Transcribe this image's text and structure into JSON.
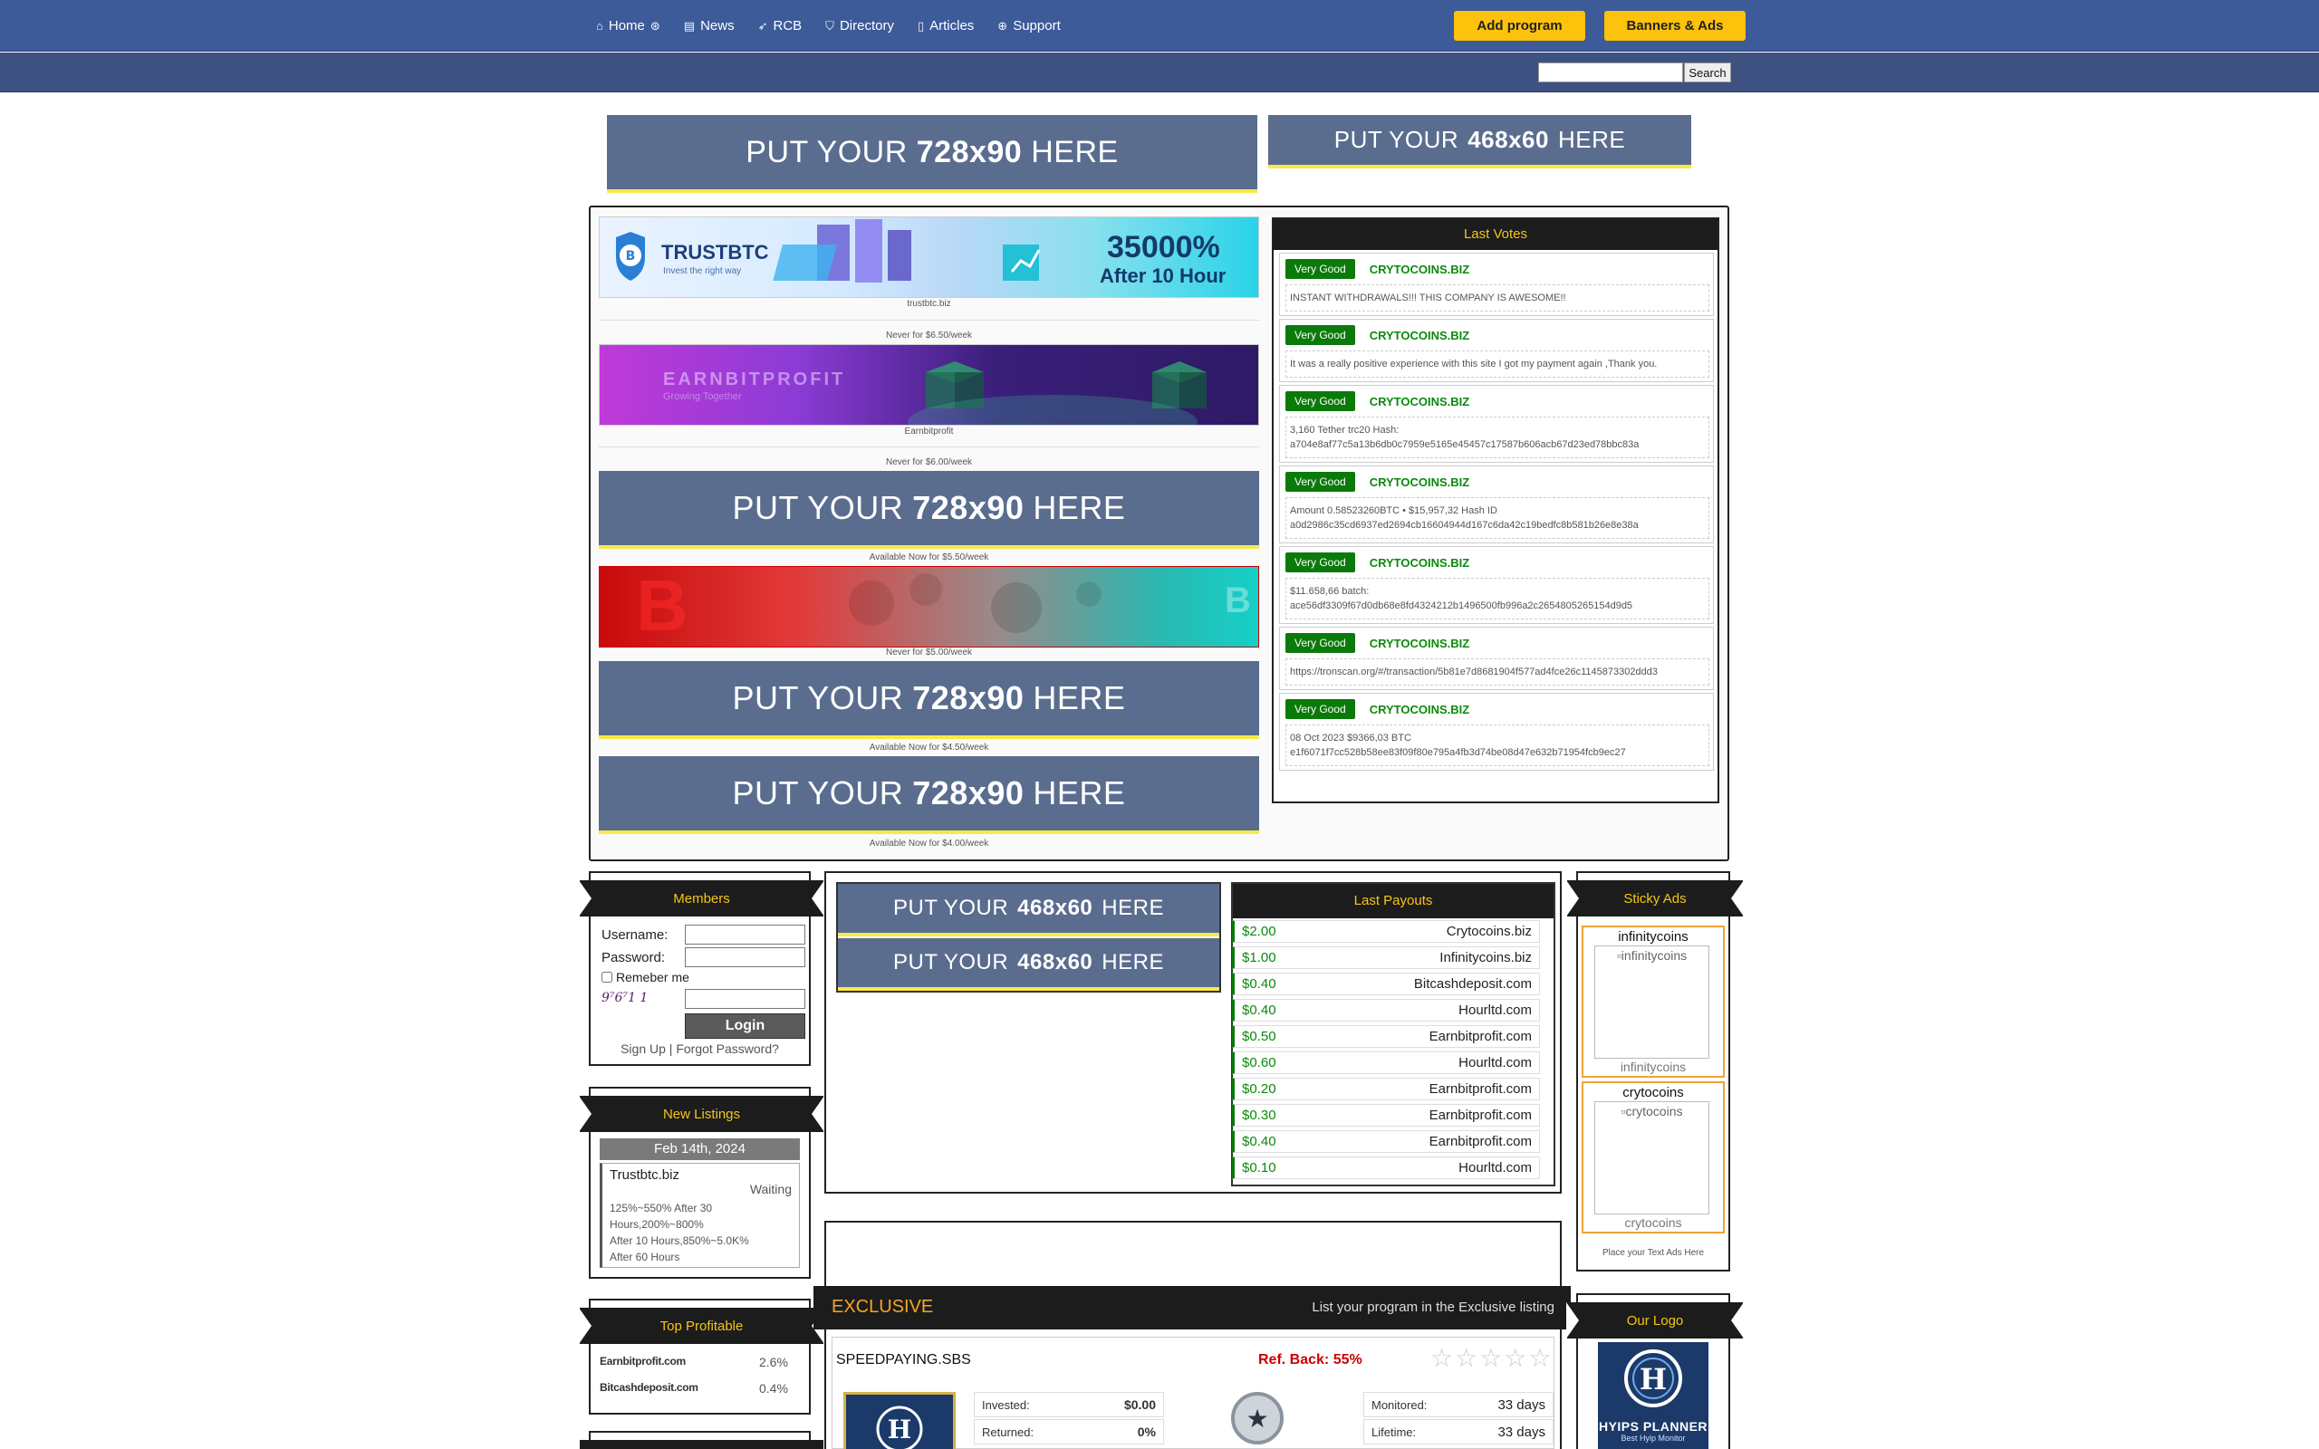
{
  "nav": {
    "items": [
      {
        "label": "Home",
        "icon": "home-icon"
      },
      {
        "label": "News",
        "icon": "newspaper-icon"
      },
      {
        "label": "RCB",
        "icon": "rocket-icon"
      },
      {
        "label": "Directory",
        "icon": "tags-icon"
      },
      {
        "label": "Articles",
        "icon": "file-icon"
      },
      {
        "label": "Support",
        "icon": "lifebuoy-icon"
      }
    ],
    "add_program": "Add program",
    "banners_ads": "Banners & Ads"
  },
  "search": {
    "button": "Search",
    "value": ""
  },
  "placeholders": {
    "put": "PUT YOUR",
    "here": "HERE",
    "size_728": "728x90",
    "size_468": "468x60"
  },
  "ads": [
    {
      "caption": "trustbtc.biz",
      "sub": "Never for $6.50/week",
      "brand": "TRUSTBTC",
      "tagline": "Invest the right way",
      "promo": "35000%",
      "promo2": "After 10 Hour"
    },
    {
      "caption": "Earnbitprofit",
      "sub": "Never for $6.00/week",
      "brand": "EARNBITPROFIT",
      "tagline": "Growing Together"
    },
    {
      "sub": "Available Now for $5.50/week"
    },
    {
      "sub": "Never for $5.00/week"
    },
    {
      "sub": "Available Now for $4.50/week"
    },
    {
      "sub": "Available Now for $4.00/week"
    }
  ],
  "last_votes": {
    "title": "Last Votes",
    "items": [
      {
        "rating": "Very Good",
        "site": "CRYTOCOINS.BIZ",
        "text": [
          "INSTANT WITHDRAWALS!!! THIS COMPANY IS AWESOME!!"
        ]
      },
      {
        "rating": "Very Good",
        "site": "CRYTOCOINS.BIZ",
        "text": [
          "It was a really positive experience with this site I got my payment again ,Thank you."
        ]
      },
      {
        "rating": "Very Good",
        "site": "CRYTOCOINS.BIZ",
        "text": [
          "3,160 Tether trc20 Hash:",
          "a704e8af77c5a13b6db0c7959e5165e45457c17587b606acb67d23ed78bbc83a"
        ]
      },
      {
        "rating": "Very Good",
        "site": "CRYTOCOINS.BIZ",
        "text": [
          "Amount 0.58523260BTC • $15,957,32 Hash ID",
          "a0d2986c35cd6937ed2694cb16604944d167c6da42c19bedfc8b581b26e8e38a"
        ]
      },
      {
        "rating": "Very Good",
        "site": "CRYTOCOINS.BIZ",
        "text": [
          "$11.658,66 batch:",
          "ace56df3309f67d0db68e8fd4324212b1496500fb996a2c2654805265154d9d5"
        ]
      },
      {
        "rating": "Very Good",
        "site": "CRYTOCOINS.BIZ",
        "text": [
          "https://tronscan.org/#/transaction/5b81e7d8681904f577ad4fce26c1145873302ddd3"
        ]
      },
      {
        "rating": "Very Good",
        "site": "CRYTOCOINS.BIZ",
        "text": [
          "08 Oct 2023 $9366,03 BTC",
          "e1f6071f7cc528b58ee83f09f80e795a4fb3d74be08d47e632b71954fcb9ec27"
        ]
      }
    ]
  },
  "members": {
    "title": "Members",
    "username_label": "Username:",
    "password_label": "Password:",
    "remember": "Remeber me",
    "captcha": "9⁷6⁷1 1",
    "login": "Login",
    "signup": "Sign Up",
    "separator": "|",
    "forgot": "Forgot Password?"
  },
  "new_listings": {
    "title": "New Listings",
    "date": "Feb 14th, 2024",
    "items": [
      {
        "name": "Trustbtc.biz",
        "status": "Waiting",
        "plan": [
          "125%~550% After 30",
          "Hours,200%~800%",
          "After 10 Hours,850%~5.0K%",
          "After 60 Hours"
        ]
      }
    ]
  },
  "top_profitable": {
    "title": "Top Profitable",
    "items": [
      {
        "site": "Earnbitprofit.com",
        "value": "2.6%"
      },
      {
        "site": "Bitcashdeposit.com",
        "value": "0.4%"
      }
    ]
  },
  "last_payouts": {
    "title": "Last Payouts",
    "items": [
      {
        "amount": "$2.00",
        "site": "Crytocoins.biz"
      },
      {
        "amount": "$1.00",
        "site": "Infinitycoins.biz"
      },
      {
        "amount": "$0.40",
        "site": "Bitcashdeposit.com"
      },
      {
        "amount": "$0.40",
        "site": "Hourltd.com"
      },
      {
        "amount": "$0.50",
        "site": "Earnbitprofit.com"
      },
      {
        "amount": "$0.60",
        "site": "Hourltd.com"
      },
      {
        "amount": "$0.20",
        "site": "Earnbitprofit.com"
      },
      {
        "amount": "$0.30",
        "site": "Earnbitprofit.com"
      },
      {
        "amount": "$0.40",
        "site": "Earnbitprofit.com"
      },
      {
        "amount": "$0.10",
        "site": "Hourltd.com"
      }
    ]
  },
  "sticky_ads": {
    "title": "Sticky Ads",
    "items": [
      {
        "name": "infinitycoins",
        "alt": "infinitycoins",
        "caption": "infinitycoins"
      },
      {
        "name": "crytocoins",
        "alt": "crytocoins",
        "caption": "crytocoins"
      }
    ],
    "footer": "Place your Text Ads Here"
  },
  "exclusive": {
    "title": "EXCLUSIVE",
    "cta": "List your program in the Exclusive listing",
    "program": {
      "name": "SPEEDPAYING.SBS",
      "ref_back": "Ref. Back: 55%",
      "invested_label": "Invested:",
      "invested": "$0.00",
      "returned_label": "Returned:",
      "returned": "0%",
      "monitored_label": "Monitored:",
      "monitored": "33 days",
      "lifetime_label": "Lifetime:",
      "lifetime": "33 days",
      "stars": "☆☆☆☆☆"
    }
  },
  "our_logo": {
    "title": "Our Logo",
    "line1": "HYIPS PLANNER",
    "line2": "Best Hyip Monitor"
  },
  "colors": {
    "nav_bg": "#3d5a99",
    "accent_yellow": "#fcc20c",
    "header_text": "#f5c518",
    "green": "#0a7a0a"
  }
}
